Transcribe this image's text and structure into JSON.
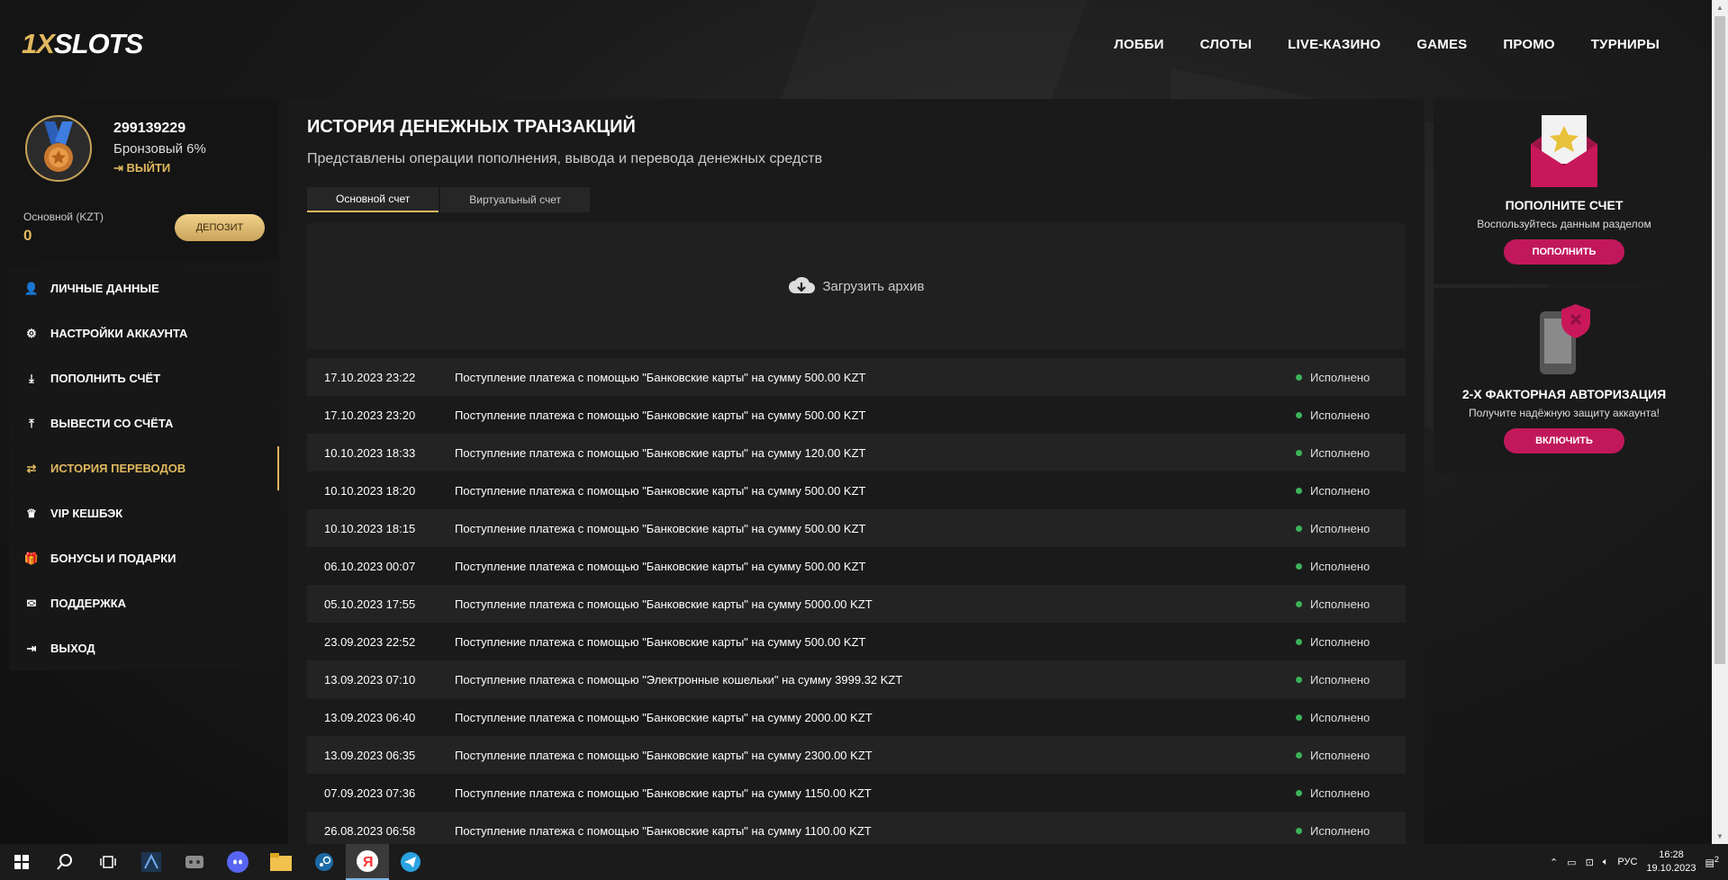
{
  "header": {
    "logo_prefix": "1X",
    "logo_suffix": "SLOTS",
    "nav": [
      "ЛОББИ",
      "СЛОТЫ",
      "LIVE-КАЗИНО",
      "GAMES",
      "ПРОМО",
      "ТУРНИРЫ"
    ]
  },
  "profile": {
    "id": "299139229",
    "rank": "Бронзовый 6%",
    "logout": "ВЫЙТИ",
    "balance_label": "Основной (KZT)",
    "balance_value": "0",
    "deposit_label": "ДЕПОЗИТ"
  },
  "menu": [
    {
      "label": "ЛИЧНЫЕ ДАННЫЕ",
      "icon": "user-plus-icon"
    },
    {
      "label": "НАСТРОЙКИ АККАУНТА",
      "icon": "gears-icon"
    },
    {
      "label": "ПОПОЛНИТЬ СЧЁТ",
      "icon": "download-icon"
    },
    {
      "label": "ВЫВЕСТИ СО СЧЁТА",
      "icon": "upload-icon"
    },
    {
      "label": "ИСТОРИЯ ПЕРЕВОДОВ",
      "icon": "transfer-icon"
    },
    {
      "label": "VIP КЕШБЭК",
      "icon": "crown-icon"
    },
    {
      "label": "БОНУСЫ И ПОДАРКИ",
      "icon": "gift-icon"
    },
    {
      "label": "ПОДДЕРЖКА",
      "icon": "mail-icon"
    },
    {
      "label": "ВЫХОД",
      "icon": "exit-icon"
    }
  ],
  "main": {
    "title": "ИСТОРИЯ ДЕНЕЖНЫХ ТРАНЗАКЦИЙ",
    "subtitle": "Представлены операции пополнения, вывода и перевода денежных средств",
    "tabs": [
      "Основной счет",
      "Виртуальный счет"
    ],
    "archive_label": "Загрузить архив",
    "transactions": [
      {
        "date": "17.10.2023 23:22",
        "desc": "Поступление платежа с помощью \"Банковские карты\" на сумму 500.00 KZT",
        "status": "Исполнено"
      },
      {
        "date": "17.10.2023 23:20",
        "desc": "Поступление платежа с помощью \"Банковские карты\" на сумму 500.00 KZT",
        "status": "Исполнено"
      },
      {
        "date": "10.10.2023 18:33",
        "desc": "Поступление платежа с помощью \"Банковские карты\" на сумму 120.00 KZT",
        "status": "Исполнено"
      },
      {
        "date": "10.10.2023 18:20",
        "desc": "Поступление платежа с помощью \"Банковские карты\" на сумму 500.00 KZT",
        "status": "Исполнено"
      },
      {
        "date": "10.10.2023 18:15",
        "desc": "Поступление платежа с помощью \"Банковские карты\" на сумму 500.00 KZT",
        "status": "Исполнено"
      },
      {
        "date": "06.10.2023 00:07",
        "desc": "Поступление платежа с помощью \"Банковские карты\" на сумму 500.00 KZT",
        "status": "Исполнено"
      },
      {
        "date": "05.10.2023 17:55",
        "desc": "Поступление платежа с помощью \"Банковские карты\" на сумму 5000.00 KZT",
        "status": "Исполнено"
      },
      {
        "date": "23.09.2023 22:52",
        "desc": "Поступление платежа с помощью \"Банковские карты\" на сумму 500.00 KZT",
        "status": "Исполнено"
      },
      {
        "date": "13.09.2023 07:10",
        "desc": "Поступление платежа с помощью \"Электронные кошельки\" на сумму 3999.32 KZT",
        "status": "Исполнено"
      },
      {
        "date": "13.09.2023 06:40",
        "desc": "Поступление платежа с помощью \"Банковские карты\" на сумму 2000.00 KZT",
        "status": "Исполнено"
      },
      {
        "date": "13.09.2023 06:35",
        "desc": "Поступление платежа с помощью \"Банковские карты\" на сумму 2300.00 KZT",
        "status": "Исполнено"
      },
      {
        "date": "07.09.2023 07:36",
        "desc": "Поступление платежа с помощью \"Банковские карты\" на сумму 1150.00 KZT",
        "status": "Исполнено"
      },
      {
        "date": "26.08.2023 06:58",
        "desc": "Поступление платежа с помощью \"Банковские карты\" на сумму 1100.00 KZT",
        "status": "Исполнено"
      }
    ]
  },
  "promos": [
    {
      "title": "ПОПОЛНИТЕ СЧЕТ",
      "text": "Воспользуйтесь данным разделом",
      "button": "ПОПОЛНИТЬ"
    },
    {
      "title": "2-Х ФАКТОРНАЯ АВТОРИЗАЦИЯ",
      "text": "Получите надёжную защиту аккаунта!",
      "button": "ВКЛЮЧИТЬ"
    }
  ],
  "taskbar": {
    "lang": "РУС",
    "time": "16:28",
    "date": "19.10.2023",
    "notifications": "2"
  },
  "colors": {
    "gold": "#e0b85e",
    "pink": "#c1185b",
    "success": "#3cb35a"
  }
}
